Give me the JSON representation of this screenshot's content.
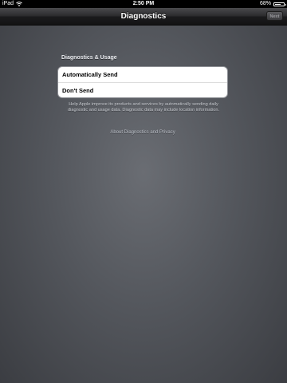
{
  "status_bar": {
    "device": "iPad",
    "time": "2:50 PM",
    "battery_percent": "68%",
    "battery_level": 0.68,
    "wifi_icon": "wifi-icon",
    "battery_icon": "battery-icon"
  },
  "nav": {
    "title": "Diagnostics",
    "next_label": "Next"
  },
  "section": {
    "header": "Diagnostics & Usage",
    "options": [
      {
        "label": "Automatically Send"
      },
      {
        "label": "Don't Send"
      }
    ],
    "description": "Help Apple improve its products and services by automatically sending daily diagnostic and usage data. Diagnostic data may include location information.",
    "about_link": "About Diagnostics and Privacy"
  }
}
